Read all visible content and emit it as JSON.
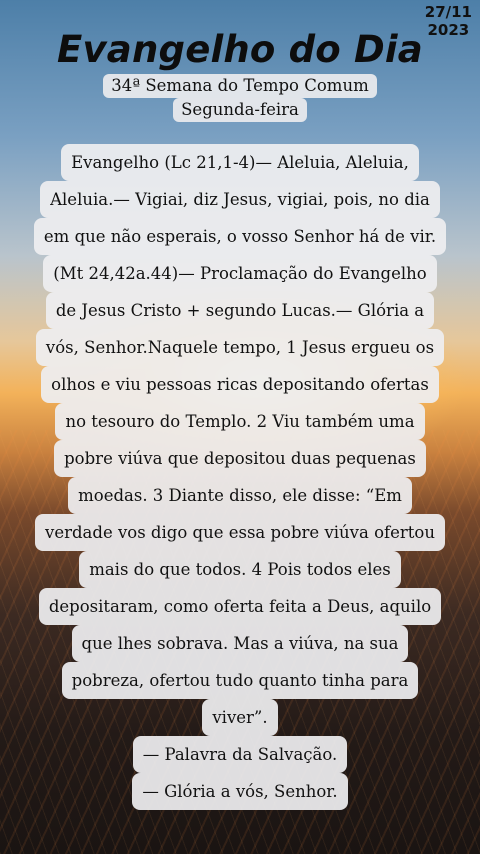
{
  "date": [
    "27/11",
    "2023"
  ],
  "title": "Evangelho do Dia",
  "subtitle": [
    "34ª Semana do Tempo Comum",
    "Segunda-feira"
  ],
  "reading_lines": [
    "Evangelho (Lc 21,1-4)— Aleluia, Aleluia,",
    "Aleluia.— Vigiai, diz Jesus, vigiai, pois, no dia",
    "em que não esperais, o vosso Senhor há de vir.",
    "(Mt 24,42a.44)— Proclamação do Evangelho",
    "de Jesus Cristo + segundo Lucas.— Glória a",
    "vós, Senhor.Naquele tempo, 1 Jesus ergueu os",
    "olhos e viu pessoas ricas depositando ofertas",
    "no tesouro do Templo. 2 Viu também uma",
    "pobre viúva que depositou duas pequenas",
    "moedas. 3 Diante disso, ele disse: “Em",
    "verdade vos digo que essa pobre viúva ofertou",
    "mais do que todos. 4 Pois todos eles",
    "depositaram, como oferta feita a Deus, aquilo",
    "que lhes sobrava. Mas a viúva, na sua",
    "pobreza, ofertou tudo quanto tinha para",
    "viver”.",
    "— Palavra da Salvação.",
    "— Glória a vós, Senhor."
  ]
}
